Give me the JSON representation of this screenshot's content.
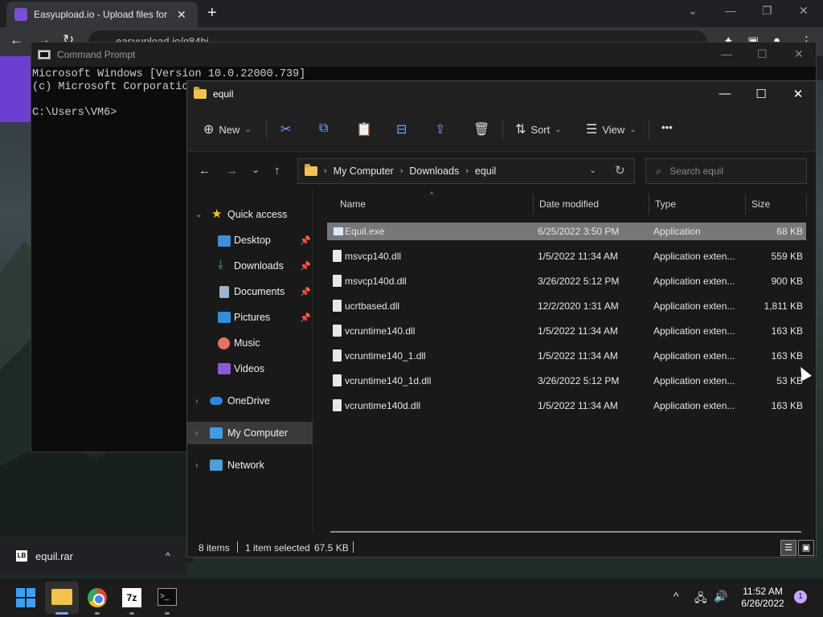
{
  "chrome": {
    "tab_title": "Easyupload.io - Upload files for f",
    "tab_close": "✕",
    "new_tab": "+",
    "address": "easyupload.io/q84bj",
    "nav_back": "←",
    "nav_forward": "→",
    "nav_reload": "↻",
    "win_min": "—",
    "win_max": "❐",
    "win_close": "✕",
    "tab_search": "⌄"
  },
  "cmd": {
    "title": "Command Prompt",
    "lines": "Microsoft Windows [Version 10.0.22000.739]\n(c) Microsoft Corporation. All rights reserved.\n\nC:\\Users\\VM6>",
    "min": "—",
    "max": "☐",
    "close": "✕"
  },
  "explorer": {
    "title": "equil",
    "min": "—",
    "max": "☐",
    "close": "✕",
    "commandbar": {
      "new_label": "New",
      "new_icon": "⊕",
      "cut_icon": "✂",
      "copy_icon": "⧉",
      "paste_icon": "📋",
      "rename_icon": "⊟",
      "share_icon": "⇪",
      "delete_icon": "🗑",
      "sort_label": "Sort",
      "sort_icon": "⇅",
      "view_label": "View",
      "view_icon": "☰",
      "more_icon": "•••",
      "chevron": "⌄"
    },
    "addressbar": {
      "back": "←",
      "forward": "→",
      "recent": "⌄",
      "up": "↑",
      "crumbs": [
        "My Computer",
        "Downloads",
        "equil"
      ],
      "crumb_sep": "›",
      "dropdown": "⌄",
      "refresh": "↻",
      "search_placeholder": "Search equil",
      "search_icon": "⌕"
    },
    "nav": {
      "quick_access": "Quick access",
      "desktop": "Desktop",
      "downloads": "Downloads",
      "documents": "Documents",
      "pictures": "Pictures",
      "music": "Music",
      "videos": "Videos",
      "onedrive": "OneDrive",
      "my_computer": "My Computer",
      "network": "Network",
      "expanded": "⌄",
      "collapsed": "›",
      "pin": "📌"
    },
    "columns": {
      "name": "Name",
      "date": "Date modified",
      "type": "Type",
      "size": "Size",
      "sort_caret": "^"
    },
    "files": [
      {
        "name": "Equil.exe",
        "date": "6/25/2022 3:50 PM",
        "type": "Application",
        "size": "68 KB"
      },
      {
        "name": "msvcp140.dll",
        "date": "1/5/2022 11:34 AM",
        "type": "Application exten...",
        "size": "559 KB"
      },
      {
        "name": "msvcp140d.dll",
        "date": "3/26/2022 5:12 PM",
        "type": "Application exten...",
        "size": "900 KB"
      },
      {
        "name": "ucrtbased.dll",
        "date": "12/2/2020 1:31 AM",
        "type": "Application exten...",
        "size": "1,811 KB"
      },
      {
        "name": "vcruntime140.dll",
        "date": "1/5/2022 11:34 AM",
        "type": "Application exten...",
        "size": "163 KB"
      },
      {
        "name": "vcruntime140_1.dll",
        "date": "1/5/2022 11:34 AM",
        "type": "Application exten...",
        "size": "163 KB"
      },
      {
        "name": "vcruntime140_1d.dll",
        "date": "3/26/2022 5:12 PM",
        "type": "Application exten...",
        "size": "53 KB"
      },
      {
        "name": "vcruntime140d.dll",
        "date": "1/5/2022 11:34 AM",
        "type": "Application exten...",
        "size": "163 KB"
      }
    ],
    "status": {
      "items": "8 items",
      "selected": "1 item selected",
      "size": "67.5 KB",
      "details_view_icon": "☰",
      "tiles_view_icon": "▣"
    }
  },
  "download": {
    "filename": "equil.rar",
    "icon_text": "LB",
    "chevron": "^"
  },
  "taskbar": {
    "seven_zip": "7z",
    "cmd_icon": ">_",
    "tray_chevron": "^",
    "network_icon": "🖧",
    "volume_icon": "🔊",
    "time": "11:52 AM",
    "date": "6/26/2022",
    "notification_count": "1"
  },
  "colors": {
    "selection": "#777777",
    "accent": "#6aa7ff",
    "chrome_bg": "#202124"
  }
}
